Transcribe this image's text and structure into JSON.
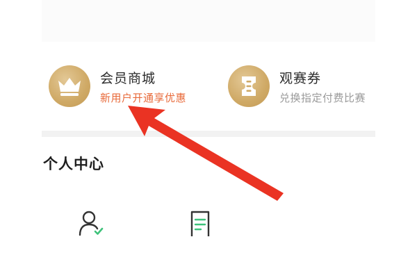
{
  "features": {
    "mall": {
      "title": "会员商城",
      "subtitle": "新用户开通享优惠",
      "icon": "crown-icon"
    },
    "ticket": {
      "title": "观赛券",
      "subtitle": "兑换指定付费比赛",
      "icon": "ticket-icon"
    }
  },
  "section": {
    "title": "个人中心"
  },
  "bottom_icons": [
    "profile-check-icon",
    "document-icon"
  ],
  "colors": {
    "gold": "#cfa965",
    "promo_red": "#e86a3a",
    "subtitle_gray": "#9a9a9a",
    "arrow_red": "#ea3323",
    "icon_green": "#3ec27a"
  }
}
